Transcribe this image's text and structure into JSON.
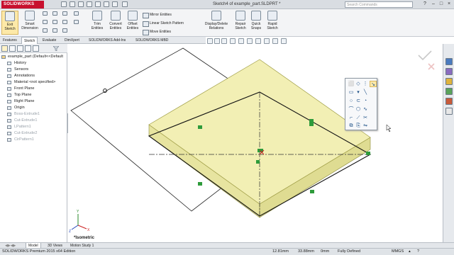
{
  "app": {
    "logo": "SOLIDWORKS",
    "document_title": "Sketch4 of example_part.SLDPRT *",
    "search_placeholder": "Search Commands"
  },
  "ribbon": {
    "exit_sketch": "Exit Sketch",
    "smart_dimension": "Smart Dimension",
    "trim_entities": "Trim Entities",
    "convert_entities": "Convert Entities",
    "offset_entities": "Offset Entities",
    "mirror_entities": "Mirror Entities",
    "linear_sketch_pattern": "Linear Sketch Pattern",
    "move_entities": "Move Entities",
    "display_delete_relations": "Display/Delete Relations",
    "repair_sketch": "Repair Sketch",
    "quick_snaps": "Quick Snaps",
    "rapid_sketch": "Rapid Sketch"
  },
  "command_tabs": [
    "Features",
    "Sketch",
    "Evaluate",
    "DimXpert",
    "SOLIDWORKS Add-Ins",
    "SOLIDWORKS MBD"
  ],
  "feature_tree": {
    "root": "example_part  (Default<<Default",
    "items": [
      {
        "label": "History",
        "greyed": false,
        "icon": "history-icon"
      },
      {
        "label": "Sensors",
        "greyed": false,
        "icon": "sensors-icon"
      },
      {
        "label": "Annotations",
        "greyed": false,
        "icon": "annotations-icon"
      },
      {
        "label": "Material <not specified>",
        "greyed": false,
        "icon": "material-icon"
      },
      {
        "label": "Front Plane",
        "greyed": false,
        "icon": "plane-icon"
      },
      {
        "label": "Top Plane",
        "greyed": false,
        "icon": "plane-icon"
      },
      {
        "label": "Right Plane",
        "greyed": false,
        "icon": "plane-icon"
      },
      {
        "label": "Origin",
        "greyed": false,
        "icon": "origin-icon"
      },
      {
        "label": "Boss-Extrude1",
        "greyed": true,
        "icon": "extrude-icon"
      },
      {
        "label": "Cut-Extrude1",
        "greyed": true,
        "icon": "cut-extrude-icon"
      },
      {
        "label": "LPattern1",
        "greyed": true,
        "icon": "pattern-icon"
      },
      {
        "label": "Cut-Extrude2",
        "greyed": true,
        "icon": "cut-extrude-icon"
      },
      {
        "label": "CirPattern1",
        "greyed": true,
        "icon": "pattern-icon"
      }
    ]
  },
  "viewport": {
    "view_orientation": "*Isometric"
  },
  "bottom_tabs": [
    "Model",
    "3D Views",
    "Motion Study 1"
  ],
  "status": {
    "edition": "SOLIDWORKS Premium 2015 x64 Edition",
    "x": "12.81mm",
    "y": "33.88mm",
    "z": "0mm",
    "state": "Fully Defined",
    "units": "MMGS"
  },
  "colors": {
    "accent": "#c8102e",
    "part_face": "#f2efb4",
    "relation_green": "#2e9b3b",
    "selection_highlight": "#fde9a8"
  }
}
